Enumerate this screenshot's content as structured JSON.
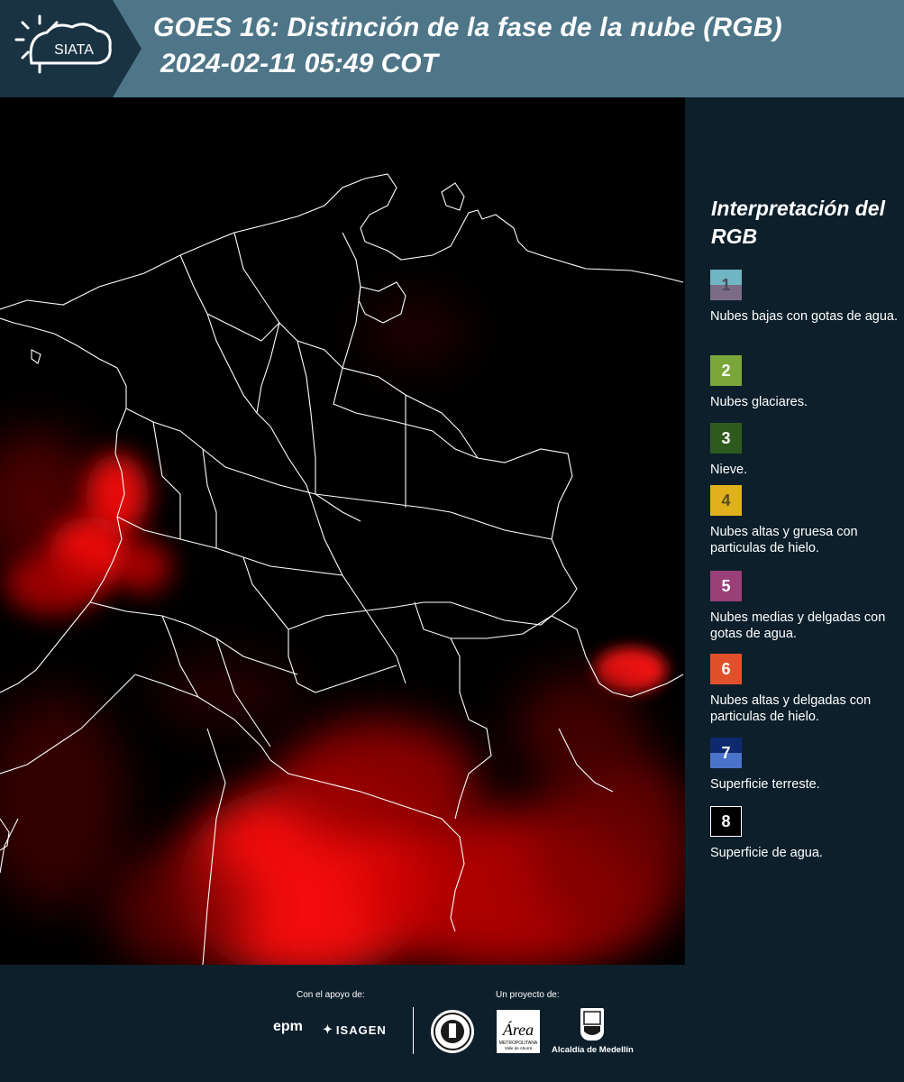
{
  "header": {
    "logo_text": "SIATA",
    "title_line1": "GOES 16: Distinción de la fase de la nube (RGB)",
    "title_line2": "2024-02-11 05:49 COT"
  },
  "legend": {
    "title": "Interpretación del RGB",
    "items": [
      {
        "number": "1",
        "label": "Nubes bajas con gotas de agua.",
        "color_top": "#6fb5c4",
        "color_bottom": "#7b6b86"
      },
      {
        "number": "2",
        "label": "Nubes glaciares.",
        "color_top": "#7ba63a",
        "color_bottom": "#7ba63a"
      },
      {
        "number": "3",
        "label": "Nieve.",
        "color_top": "#2f5a1f",
        "color_bottom": "#2f5a1f"
      },
      {
        "number": "4",
        "label": "Nubes altas y gruesa con particulas de hielo.",
        "color_top": "#e0b11c",
        "color_bottom": "#e0b11c"
      },
      {
        "number": "5",
        "label": "Nubes medias y delgadas con gotas de agua.",
        "color_top": "#9a3f78",
        "color_bottom": "#9a3f78"
      },
      {
        "number": "6",
        "label": "Nubes altas y delgadas con particulas de hielo.",
        "color_top": "#e0502a",
        "color_bottom": "#e0502a"
      },
      {
        "number": "7",
        "label": "Superficie terreste.",
        "color_top": "#0e2a6e",
        "color_bottom": "#4a74c9"
      },
      {
        "number": "8",
        "label": "Superficie de agua.",
        "color_top": "#000000",
        "color_bottom": "#000000"
      }
    ]
  },
  "footer": {
    "support_label": "Con el apoyo de:",
    "project_label": "Un proyecto de:",
    "epm": "epm",
    "isagen": "ISAGEN",
    "area_text": "METROPOLITANA",
    "area_text2": "Valle de Aburrá",
    "alcaldia": "Alcaldía de Medellín"
  },
  "colors": {
    "header_bg": "#4e7688",
    "panel_bg": "#0d1f2b",
    "cloud_red": "#ff1a1a"
  }
}
